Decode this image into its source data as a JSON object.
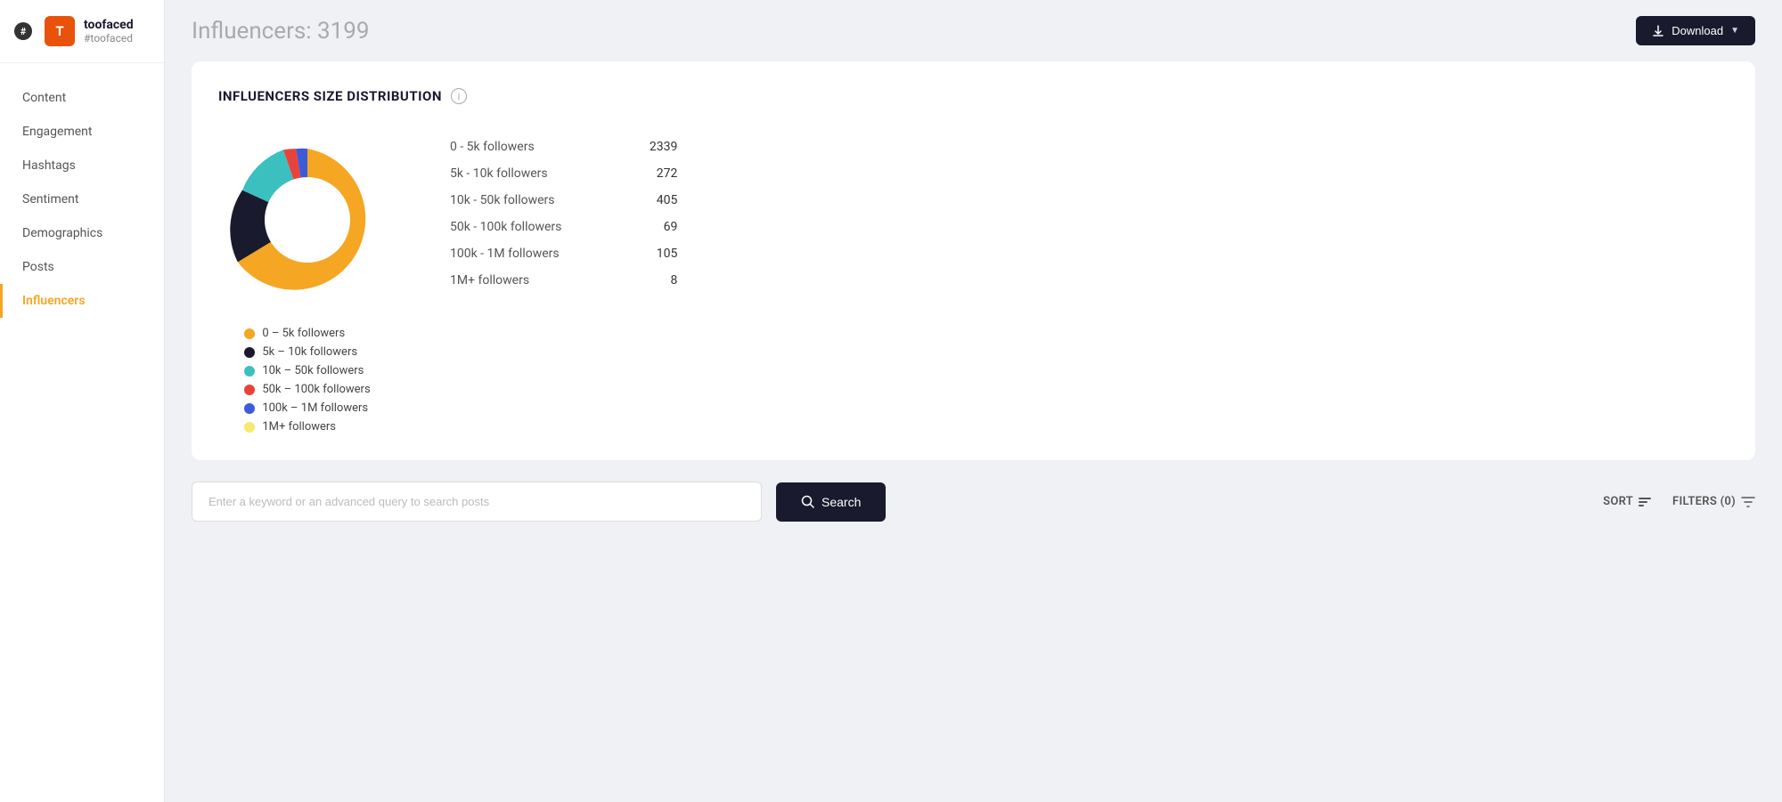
{
  "brand": {
    "avatar_letter": "T",
    "name": "toofaced",
    "handle": "#toofaced"
  },
  "nav": {
    "items": [
      {
        "id": "content",
        "label": "Content",
        "active": false
      },
      {
        "id": "engagement",
        "label": "Engagement",
        "active": false
      },
      {
        "id": "hashtags",
        "label": "Hashtags",
        "active": false
      },
      {
        "id": "sentiment",
        "label": "Sentiment",
        "active": false
      },
      {
        "id": "demographics",
        "label": "Demographics",
        "active": false
      },
      {
        "id": "posts",
        "label": "Posts",
        "active": false
      },
      {
        "id": "influencers",
        "label": "Influencers",
        "active": true
      }
    ]
  },
  "header": {
    "title": "Influencers: 3199",
    "download_label": "Download"
  },
  "chart_card": {
    "title": "INFLUENCERS SIZE DISTRIBUTION",
    "info_icon": "i",
    "legend": [
      {
        "id": "0-5k",
        "label": "0 – 5k followers",
        "color": "#f5a623"
      },
      {
        "id": "5k-10k",
        "label": "5k – 10k followers",
        "color": "#1a1a2e"
      },
      {
        "id": "10k-50k",
        "label": "10k – 50k followers",
        "color": "#3bbfbf"
      },
      {
        "id": "50k-100k",
        "label": "50k – 100k followers",
        "color": "#e8433a"
      },
      {
        "id": "100k-1m",
        "label": "100k – 1M followers",
        "color": "#3b5bdb"
      },
      {
        "id": "1m+",
        "label": "1M+ followers",
        "color": "#f5e96e"
      }
    ],
    "stats": [
      {
        "label": "0 - 5k followers",
        "value": "2339"
      },
      {
        "label": "5k - 10k followers",
        "value": "272"
      },
      {
        "label": "10k - 50k followers",
        "value": "405"
      },
      {
        "label": "50k - 100k followers",
        "value": "69"
      },
      {
        "label": "100k - 1M followers",
        "value": "105"
      },
      {
        "label": "1M+ followers",
        "value": "8"
      }
    ],
    "donut": {
      "segments": [
        {
          "label": "0-5k",
          "value": 2339,
          "color": "#f5a623",
          "pct": 73.1
        },
        {
          "label": "5k-10k",
          "value": 272,
          "color": "#1a1a2e",
          "pct": 8.5
        },
        {
          "label": "10k-50k",
          "value": 405,
          "color": "#3bbfbf",
          "pct": 12.7
        },
        {
          "label": "50k-100k",
          "value": 69,
          "color": "#e8433a",
          "pct": 2.2
        },
        {
          "label": "100k-1m",
          "value": 105,
          "color": "#3b5bdb",
          "pct": 3.3
        },
        {
          "label": "1m+",
          "value": 8,
          "color": "#f5e96e",
          "pct": 0.2
        }
      ]
    }
  },
  "search": {
    "placeholder": "Enter a keyword or an advanced query to search posts",
    "button_label": "Search",
    "sort_label": "SORT",
    "filters_label": "FILTERS (0)"
  }
}
